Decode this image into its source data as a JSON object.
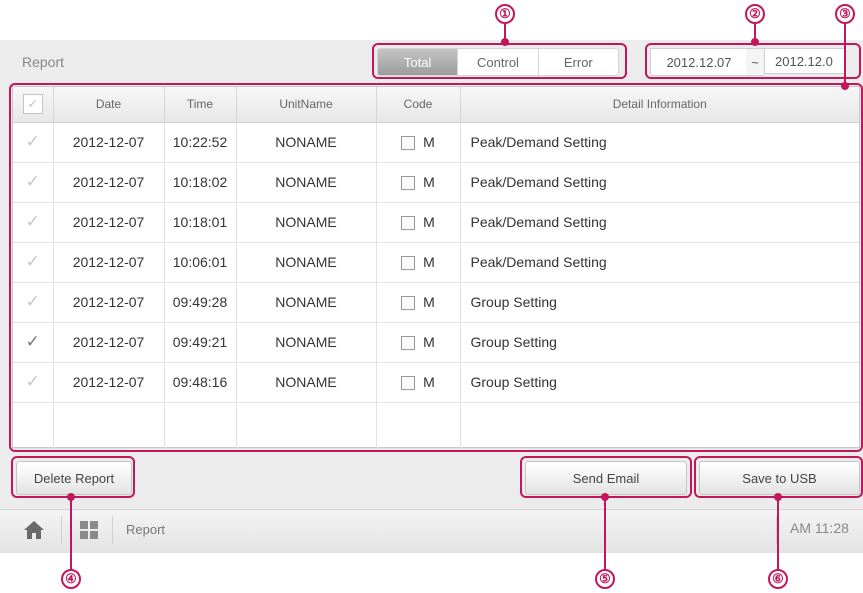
{
  "header": {
    "title": "Report"
  },
  "tabs": [
    {
      "label": "Total",
      "active": true
    },
    {
      "label": "Control",
      "active": false
    },
    {
      "label": "Error",
      "active": false
    }
  ],
  "date_range": {
    "from": "2012.12.07",
    "separator": "~",
    "to": "2012.12.0"
  },
  "table": {
    "columns": [
      "Date",
      "Time",
      "UnitName",
      "Code",
      "Detail Information"
    ],
    "rows": [
      {
        "checked": false,
        "date": "2012-12-07",
        "time": "10:22:52",
        "unit": "NONAME",
        "code": "M",
        "detail": "Peak/Demand Setting"
      },
      {
        "checked": false,
        "date": "2012-12-07",
        "time": "10:18:02",
        "unit": "NONAME",
        "code": "M",
        "detail": "Peak/Demand Setting"
      },
      {
        "checked": false,
        "date": "2012-12-07",
        "time": "10:18:01",
        "unit": "NONAME",
        "code": "M",
        "detail": "Peak/Demand Setting"
      },
      {
        "checked": false,
        "date": "2012-12-07",
        "time": "10:06:01",
        "unit": "NONAME",
        "code": "M",
        "detail": "Peak/Demand Setting"
      },
      {
        "checked": false,
        "date": "2012-12-07",
        "time": "09:49:28",
        "unit": "NONAME",
        "code": "M",
        "detail": "Group Setting"
      },
      {
        "checked": true,
        "date": "2012-12-07",
        "time": "09:49:21",
        "unit": "NONAME",
        "code": "M",
        "detail": "Group Setting"
      },
      {
        "checked": false,
        "date": "2012-12-07",
        "time": "09:48:16",
        "unit": "NONAME",
        "code": "M",
        "detail": "Group Setting"
      }
    ]
  },
  "buttons": {
    "delete": "Delete Report",
    "email": "Send Email",
    "usb": "Save to USB"
  },
  "bottom_bar": {
    "label": "Report",
    "clock": "AM 11:28",
    "icons": [
      "home-icon",
      "menu-grid-icon"
    ]
  },
  "callouts": [
    "①",
    "②",
    "③",
    "④",
    "⑤",
    "⑥"
  ],
  "colors": {
    "callout": "#c2185b",
    "active_tab": "#a8a8a8",
    "panel": "#ececec"
  }
}
